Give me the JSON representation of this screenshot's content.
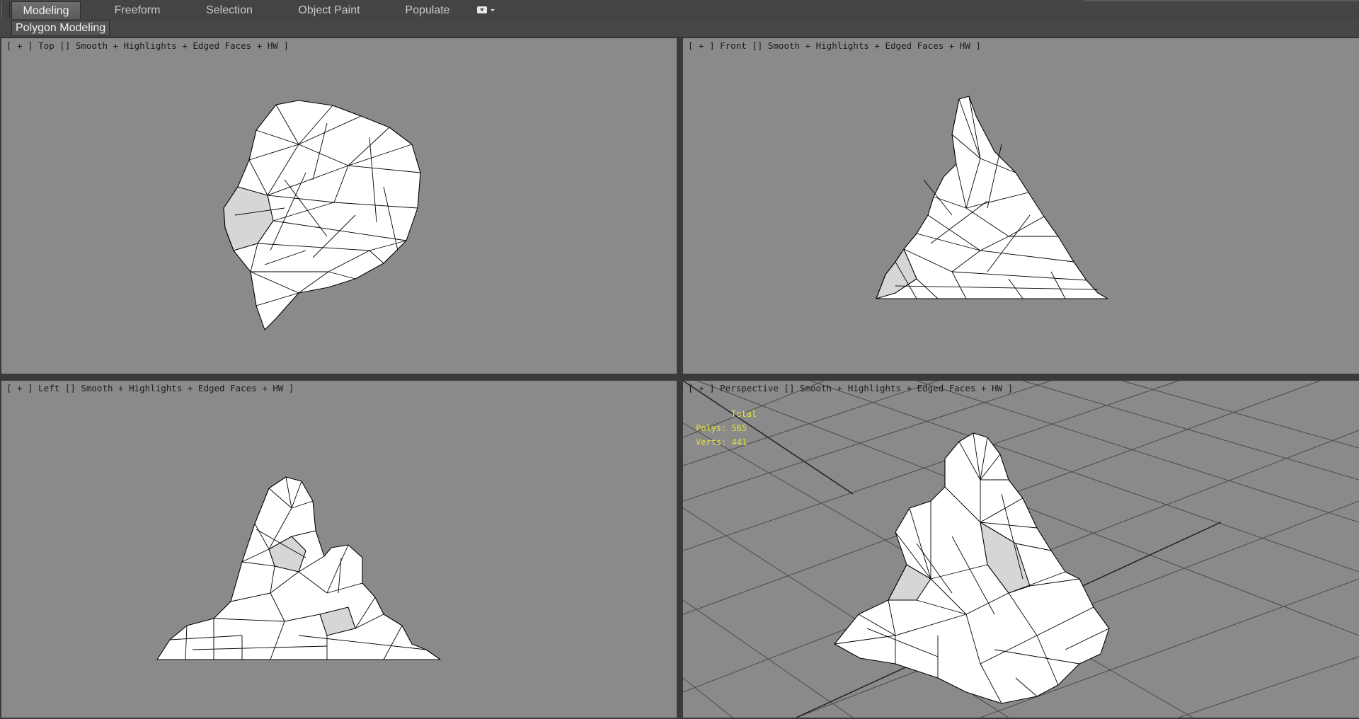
{
  "ribbon": {
    "tabs": [
      {
        "label": "Modeling",
        "active": true
      },
      {
        "label": "Freeform",
        "active": false
      },
      {
        "label": "Selection",
        "active": false
      },
      {
        "label": "Object Paint",
        "active": false
      },
      {
        "label": "Populate",
        "active": false
      }
    ],
    "extra_icon": "panel-options-icon",
    "panel_label": "Polygon Modeling"
  },
  "viewports": {
    "top": {
      "label": "[ + ] Top [] Smooth + Highlights + Edged Faces + HW ]"
    },
    "front": {
      "label": "[ + ] Front [] Smooth + Highlights + Edged Faces + HW ]"
    },
    "left": {
      "label": "[ + ] Left [] Smooth + Highlights + Edged Faces + HW ]"
    },
    "perspective": {
      "label": "[ + ] Perspective [] Smooth + Highlights + Edged Faces + HW ]",
      "stats": {
        "total_label": "Total",
        "polys": "Polys: 565",
        "verts": "Verts: 441"
      }
    }
  },
  "colors": {
    "viewport_bg": "#8a8a8a",
    "stats_text": "#e3e33a",
    "ui_bg": "#444444"
  }
}
